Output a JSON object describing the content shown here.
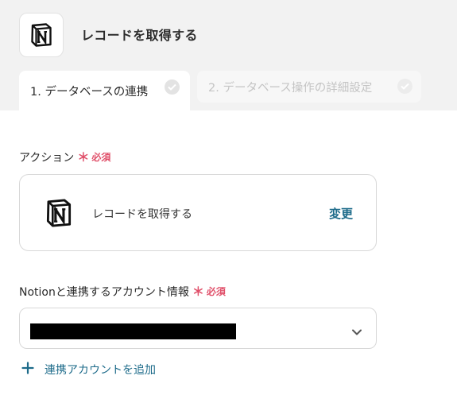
{
  "header": {
    "app_icon": "notion-logo-icon",
    "title": "レコードを取得する"
  },
  "tabs": [
    {
      "label": "1. データベースの連携",
      "active": true,
      "icon": "check-circle-icon"
    },
    {
      "label": "2. データベース操作の詳細設定",
      "active": false,
      "icon": "check-circle-icon"
    }
  ],
  "action_field": {
    "label": "アクション",
    "required_label": "必須",
    "card": {
      "icon": "notion-logo-icon",
      "text": "レコードを取得する",
      "change_label": "変更"
    }
  },
  "account_field": {
    "label": "Notionと連携するアカウント情報",
    "required_label": "必須",
    "select_icon": "chevron-down-icon",
    "add_account_label": "連携アカウントを追加",
    "add_icon": "plus-icon"
  },
  "colors": {
    "required": "#e0506a",
    "link": "#1d6b8a",
    "header_bg": "#f2f2f2"
  }
}
